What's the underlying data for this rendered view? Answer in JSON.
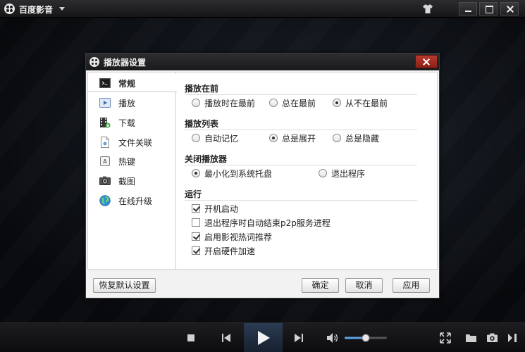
{
  "app": {
    "title": "百度影音"
  },
  "dialog": {
    "title": "播放器设置",
    "nav": [
      {
        "label": "常规",
        "icon": "terminal-icon",
        "active": true
      },
      {
        "label": "播放",
        "icon": "play-icon",
        "active": false
      },
      {
        "label": "下载",
        "icon": "download-film-icon",
        "active": false
      },
      {
        "label": "文件关联",
        "icon": "file-icon",
        "active": false
      },
      {
        "label": "热键",
        "icon": "hotkey-icon",
        "active": false
      },
      {
        "label": "截图",
        "icon": "camera-icon",
        "active": false
      },
      {
        "label": "在线升级",
        "icon": "globe-icon",
        "active": false
      }
    ],
    "sections": {
      "on_top": {
        "title": "播放在前",
        "options": [
          {
            "label": "播放时在最前",
            "selected": false
          },
          {
            "label": "总在最前",
            "selected": false
          },
          {
            "label": "从不在最前",
            "selected": true
          }
        ]
      },
      "playlist": {
        "title": "播放列表",
        "options": [
          {
            "label": "自动记忆",
            "selected": false
          },
          {
            "label": "总是展开",
            "selected": true
          },
          {
            "label": "总是隐藏",
            "selected": false
          }
        ]
      },
      "close_player": {
        "title": "关闭播放器",
        "options": [
          {
            "label": "最小化到系统托盘",
            "selected": true
          },
          {
            "label": "退出程序",
            "selected": false
          }
        ]
      },
      "run": {
        "title": "运行",
        "options": [
          {
            "label": "开机启动",
            "checked": true
          },
          {
            "label": "退出程序时自动结束p2p服务进程",
            "checked": false
          },
          {
            "label": "启用影视热词推荐",
            "checked": true
          },
          {
            "label": "开启硬件加速",
            "checked": true
          }
        ]
      }
    },
    "buttons": {
      "reset": "恢复默认设置",
      "ok": "确定",
      "cancel": "取消",
      "apply": "应用"
    }
  },
  "controls": {
    "volume_level": 0.5
  },
  "colors": {
    "accent": "#2b3b52",
    "close_red": "#b83a2e"
  }
}
